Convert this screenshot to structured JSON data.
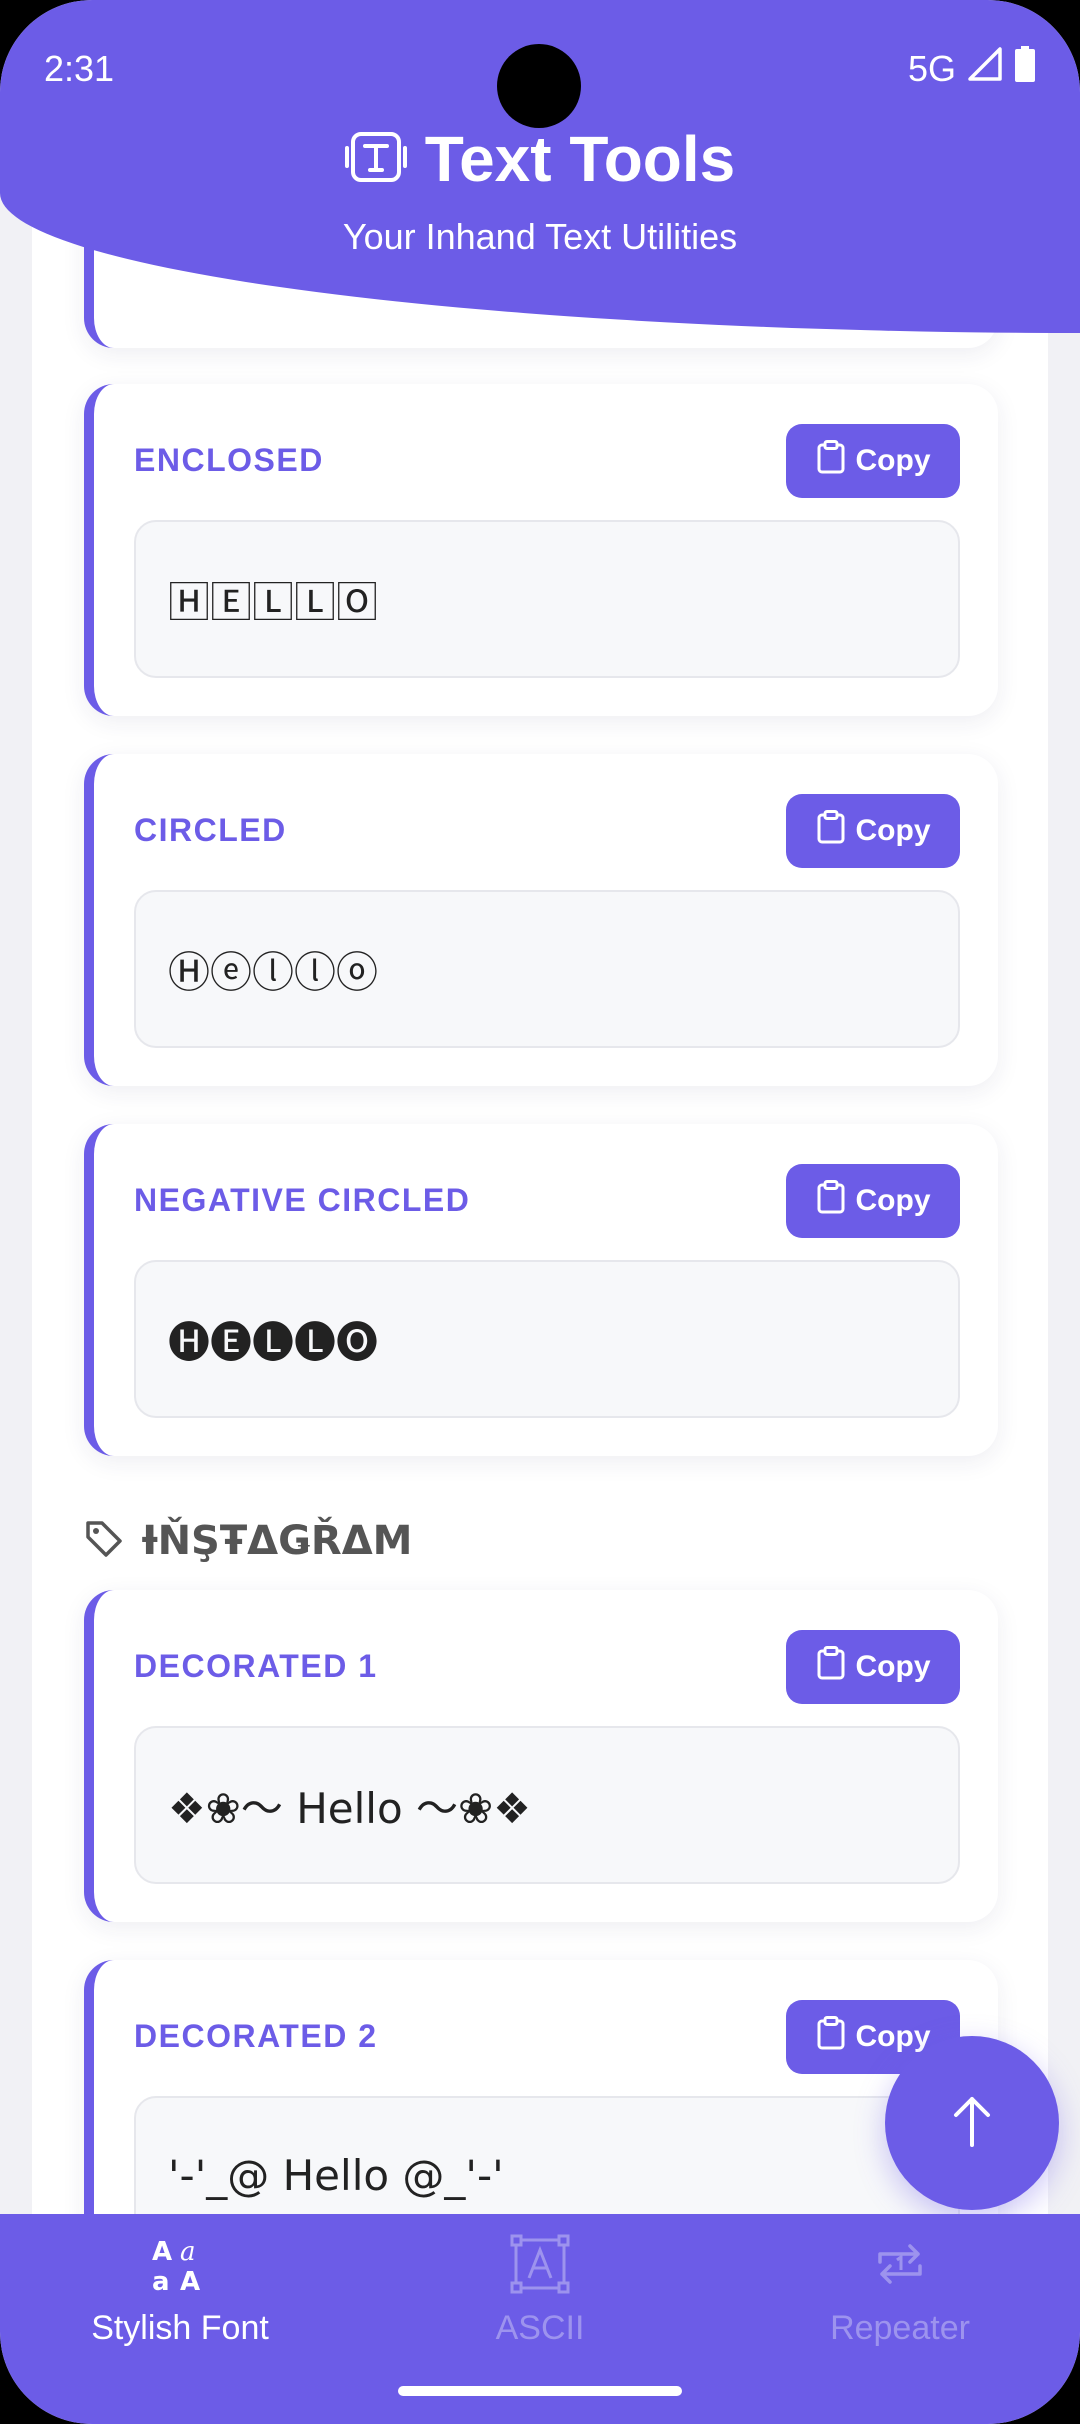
{
  "status_bar": {
    "time": "2:31",
    "network": "5G"
  },
  "header": {
    "title": "Text Tools",
    "subtitle": "Your Inhand Text Utilities"
  },
  "cards": [
    {
      "label": "ENCLOSED",
      "copy_label": "Copy",
      "result": "🄷🄴🄻🄻🄾"
    },
    {
      "label": "CIRCLED",
      "copy_label": "Copy",
      "result": "Ⓗⓔⓛⓛⓞ"
    },
    {
      "label": "NEGATIVE CIRCLED",
      "copy_label": "Copy",
      "result": "🅗🅔🅛🅛🅞"
    },
    {
      "label": "DECORATED 1",
      "copy_label": "Copy",
      "result": "❖❀〜 Hello 〜❀❖"
    },
    {
      "label": "DECORATED 2",
      "copy_label": "Copy",
      "result": "'-'_@ Hello @_'-'"
    }
  ],
  "section": {
    "title": "ƗŇŞŦΔǤŘΔM"
  },
  "bottom_nav": {
    "items": [
      {
        "label": "Stylish Font",
        "active": true
      },
      {
        "label": "ASCII",
        "active": false
      },
      {
        "label": "Repeater",
        "active": false
      }
    ]
  },
  "colors": {
    "accent": "#6c5ce7",
    "inactive_nav": "#9d93ee"
  }
}
